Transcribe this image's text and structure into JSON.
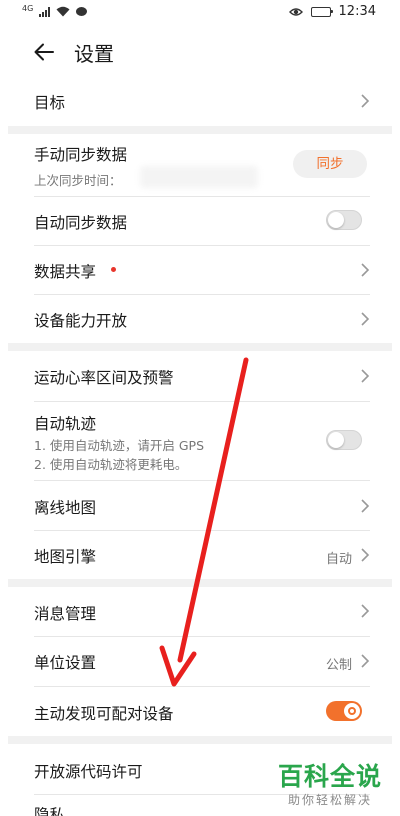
{
  "status_bar": {
    "network_label": "4G",
    "time": "12:34"
  },
  "header": {
    "title": "设置"
  },
  "rows": {
    "goal": {
      "label": "目标"
    },
    "manual_sync": {
      "label": "手动同步数据",
      "sub": "上次同步时间：",
      "button": "同步"
    },
    "auto_sync": {
      "label": "自动同步数据",
      "toggle": "off"
    },
    "data_share": {
      "label": "数据共享"
    },
    "device_capability": {
      "label": "设备能力开放"
    },
    "heart_rate": {
      "label": "运动心率区间及预警"
    },
    "auto_track": {
      "label": "自动轨迹",
      "sub1": "1. 使用自动轨迹，请开启 GPS",
      "sub2": "2. 使用自动轨迹将更耗电。",
      "toggle": "off"
    },
    "offline_map": {
      "label": "离线地图"
    },
    "map_engine": {
      "label": "地图引擎",
      "value": "自动"
    },
    "message_mgmt": {
      "label": "消息管理"
    },
    "unit_settings": {
      "label": "单位设置",
      "value": "公制"
    },
    "discover_devices": {
      "label": "主动发现可配对设备",
      "toggle": "on"
    },
    "open_source": {
      "label": "开放源代码许可"
    },
    "privacy": {
      "label": "隐私"
    }
  },
  "watermark": {
    "main": "百科全说",
    "sub": "助你轻松解决"
  },
  "colors": {
    "accent": "#f2712c",
    "annotation_arrow": "#e8201e",
    "watermark_green": "#2aa64c"
  }
}
